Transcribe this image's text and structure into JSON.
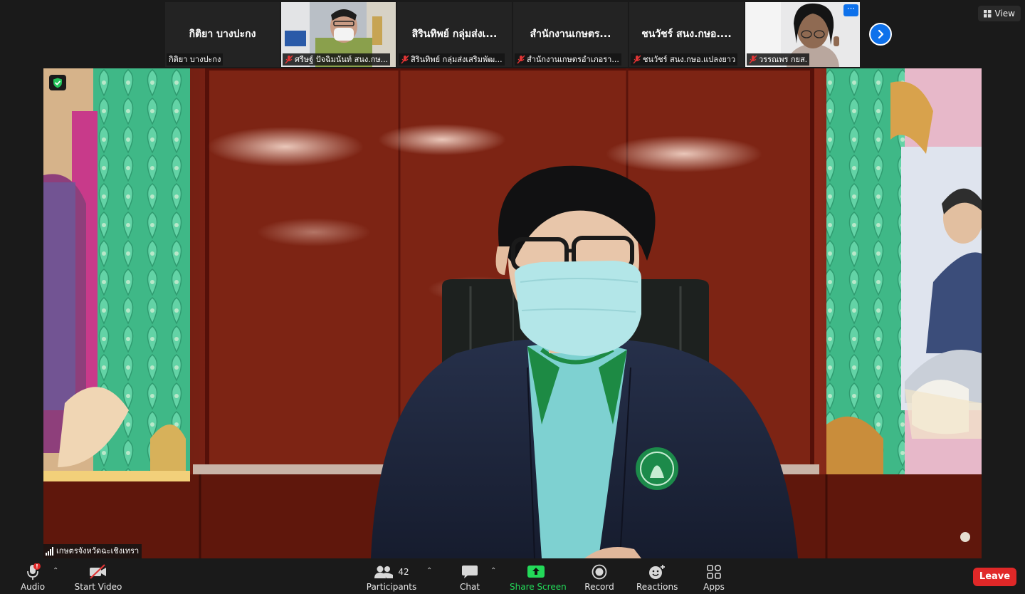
{
  "gallery": {
    "tiles": [
      {
        "big_name": "กิติยา บางปะกง",
        "tag": "กิติยา บางปะกง"
      },
      {
        "big_name": "",
        "tag": "ศรีษฐ์ ปัจฉิมนันท์ สนง.กษ..."
      },
      {
        "big_name": "สิรินทิพย์ กลุ่มส่งเ...",
        "tag": "สิรินทิพย์ กลุ่มส่งเสริมพัฒ..."
      },
      {
        "big_name": "สำนักงานเกษตร...",
        "tag": "สำนักงานเกษตรอำเภอรา..."
      },
      {
        "big_name": "ชนวัชร์ สนง.กษอ....",
        "tag": "ชนวัชร์ สนง.กษอ.แปลงยาว"
      },
      {
        "big_name": "",
        "tag": "วรรณพร กยส."
      }
    ],
    "more_label": "···",
    "view_label": "View"
  },
  "main_video": {
    "speaker_name": "เกษตรจังหวัดฉะเชิงเทรา"
  },
  "toolbar": {
    "audio": "Audio",
    "start_video": "Start Video",
    "participants": "Participants",
    "participants_count": "42",
    "chat": "Chat",
    "share_screen": "Share Screen",
    "record": "Record",
    "reactions": "Reactions",
    "apps": "Apps",
    "leave": "Leave",
    "audio_alert": "!"
  },
  "colors": {
    "accent_blue": "#0e71eb",
    "share_green": "#23d959",
    "leave_red": "#e02828",
    "mute_red": "#e03535"
  }
}
